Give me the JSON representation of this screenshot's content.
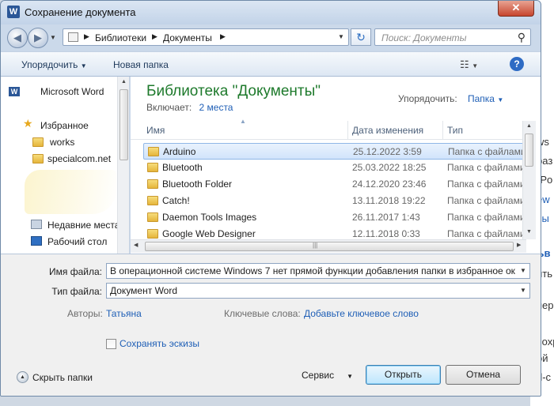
{
  "window": {
    "title": "Сохранение документа",
    "close_label": "✕"
  },
  "background_doc_fragments": [
    "ws",
    "раз",
    "rPo",
    "ew",
    "сы",
    "ъв",
    "ить",
    "пер",
    "сохр",
    "ой",
    "d-c"
  ],
  "address_bar": {
    "crumbs": [
      "Библиотеки",
      "Документы"
    ],
    "refresh_icon": "refresh-icon"
  },
  "search": {
    "placeholder": "Поиск: Документы"
  },
  "toolbar": {
    "organize": "Упорядочить",
    "new_folder": "Новая папка",
    "help": "?"
  },
  "nav_pane": {
    "items": [
      {
        "label": "Microsoft Word",
        "icon": "word-icon"
      },
      {
        "label": "Избранное",
        "icon": "star-icon"
      },
      {
        "label": "works",
        "icon": "folder-icon"
      },
      {
        "label": "specialcom.net",
        "icon": "folder-icon"
      },
      {
        "label": "Недавние места",
        "icon": "recent-places-icon"
      },
      {
        "label": "Рабочий стол",
        "icon": "desktop-icon"
      }
    ]
  },
  "library": {
    "title": "Библиотека \"Документы\"",
    "includes_label": "Включает:",
    "includes_value": "2 места",
    "arrange_label": "Упорядочить:",
    "arrange_value": "Папка"
  },
  "columns": {
    "name": "Имя",
    "date": "Дата изменения",
    "type": "Тип"
  },
  "files": [
    {
      "name": "Arduino",
      "date": "25.12.2022 3:59",
      "type": "Папка с файлами",
      "selected": true
    },
    {
      "name": "Bluetooth",
      "date": "25.03.2022 18:25",
      "type": "Папка с файлами"
    },
    {
      "name": "Bluetooth Folder",
      "date": "24.12.2020 23:46",
      "type": "Папка с файлами"
    },
    {
      "name": "Catch!",
      "date": "13.11.2018 19:22",
      "type": "Папка с файлами"
    },
    {
      "name": "Daemon Tools Images",
      "date": "26.11.2017 1:43",
      "type": "Папка с файлами"
    },
    {
      "name": "Google Web Designer",
      "date": "12.11.2018 0:33",
      "type": "Папка с файлами"
    }
  ],
  "form": {
    "filename_label": "Имя файла:",
    "filename_value": "В операционной системе Windows 7 нет прямой функции добавления папки в избранное ок",
    "filetype_label": "Тип файла:",
    "filetype_value": "Документ Word",
    "authors_label": "Авторы:",
    "authors_value": "Татьяна",
    "keywords_label": "Ключевые слова:",
    "keywords_value": "Добавьте ключевое слово",
    "thumbnails_label": "Сохранять эскизы",
    "hide_folders": "Скрыть папки",
    "service": "Сервис",
    "open": "Открыть",
    "cancel": "Отмена"
  }
}
